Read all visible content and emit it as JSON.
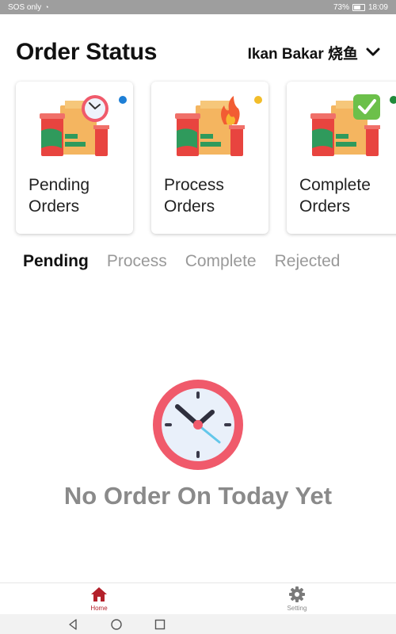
{
  "status_bar": {
    "carrier": "SOS only",
    "battery": "73%",
    "time": "18:09"
  },
  "header": {
    "title": "Order Status",
    "store_name": "Ikan Bakar 烧鱼"
  },
  "cards": [
    {
      "label_line1": "Pending",
      "label_line2": "Orders",
      "dot_color": "#1e7fd6"
    },
    {
      "label_line1": "Process",
      "label_line2": "Orders",
      "dot_color": "#f2bd2a"
    },
    {
      "label_line1": "Complete",
      "label_line2": "Orders",
      "dot_color": "#1f8a3a"
    }
  ],
  "tabs": [
    "Pending",
    "Process",
    "Complete",
    "Rejected"
  ],
  "active_tab": "Pending",
  "empty_state": {
    "message": "No Order On Today Yet"
  },
  "bottom_nav": [
    {
      "label": "Home",
      "icon": "home-icon",
      "active": true
    },
    {
      "label": "Setting",
      "icon": "gear-icon",
      "active": false
    }
  ],
  "colors": {
    "accent": "#b3202a",
    "clock_rim": "#f05a6b",
    "empty_text": "#8a8a8a"
  }
}
